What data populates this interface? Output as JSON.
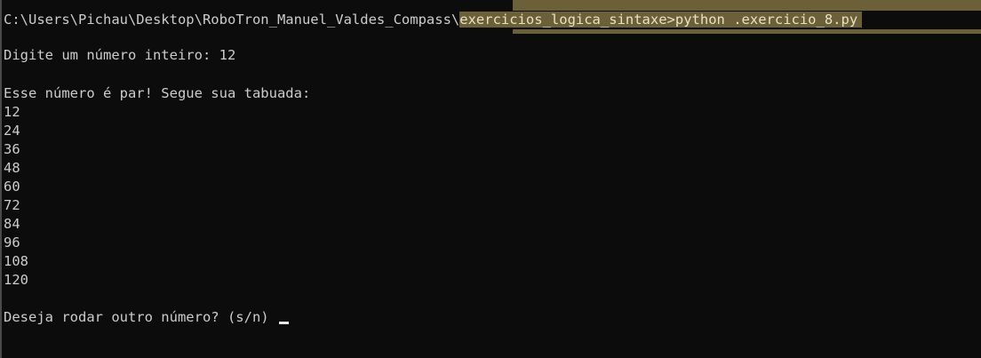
{
  "prompt": {
    "path": "C:\\Users\\Pichau\\Desktop\\RoboTron_Manuel_Valdes_Compass\\",
    "command": "exercicios_logica_sintaxe>python .exercicio_8.py"
  },
  "input_prompt": "Digite um número inteiro: 12",
  "result_header": "Esse número é par! Segue sua tabuada:",
  "table": [
    "12",
    "24",
    "36",
    "48",
    "60",
    "72",
    "84",
    "96",
    "108",
    "120"
  ],
  "question": "Deseja rodar outro número? (s/n) ",
  "colors": {
    "background": "#0c0c0c",
    "text": "#cccccc",
    "selection": "#6b6038"
  }
}
